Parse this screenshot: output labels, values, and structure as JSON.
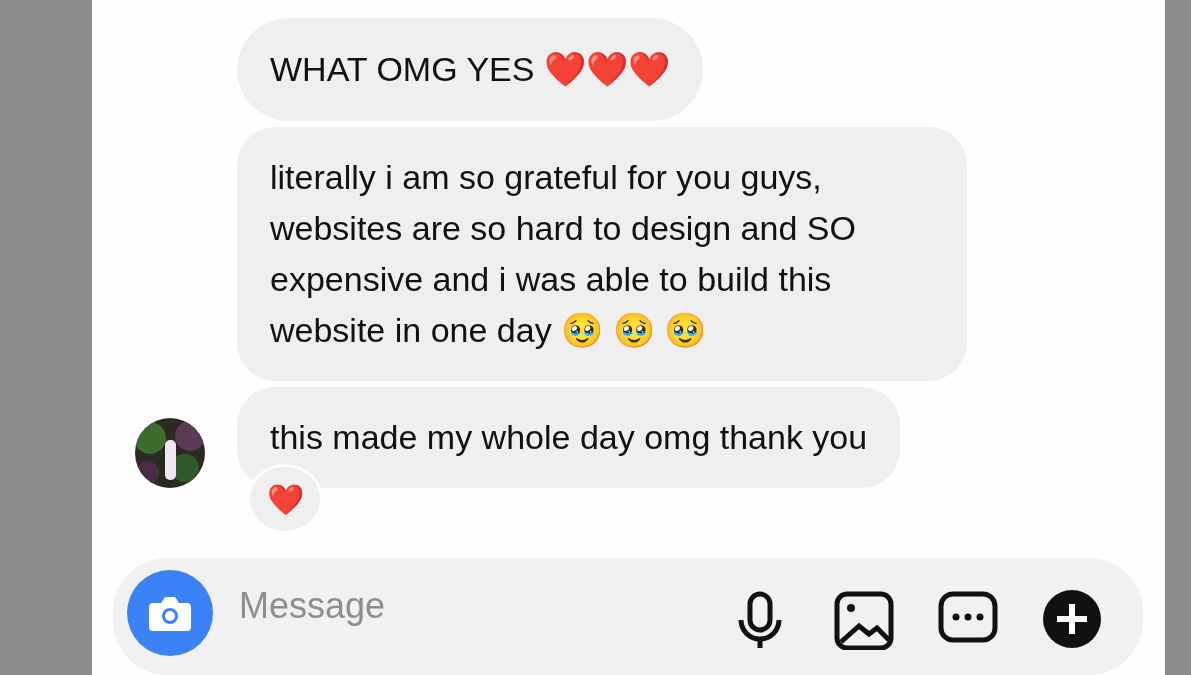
{
  "messages": [
    {
      "text": "WHAT OMG YES ❤️❤️❤️"
    },
    {
      "text": "literally i am so grateful for you guys, websites are so hard to design and SO expensive and i was able to build this website in one day 🥹 🥹 🥹"
    },
    {
      "text": "this made my whole day omg thank you",
      "reaction": "❤️"
    }
  ],
  "composer": {
    "placeholder": "Message"
  }
}
